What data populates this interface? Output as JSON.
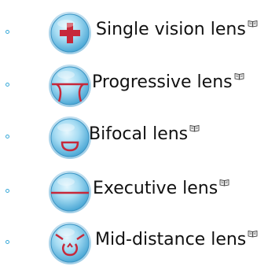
{
  "items": [
    {
      "label": "Single vision lens",
      "icon": "single-vision-lens-icon"
    },
    {
      "label": "Progressive lens",
      "icon": "progressive-lens-icon"
    },
    {
      "label": "Bifocal lens",
      "icon": "bifocal-lens-icon"
    },
    {
      "label": "Executive lens",
      "icon": "executive-lens-icon"
    },
    {
      "label": "Mid-distance lens",
      "icon": "mid-distance-lens-icon"
    }
  ],
  "link_icon": "book-icon",
  "colors": {
    "lens_light": "#d6f0fb",
    "lens_mid": "#86cdee",
    "lens_dark": "#3a9fd0",
    "red_mark": "#c6283a",
    "bullet": "#39a9d8"
  }
}
